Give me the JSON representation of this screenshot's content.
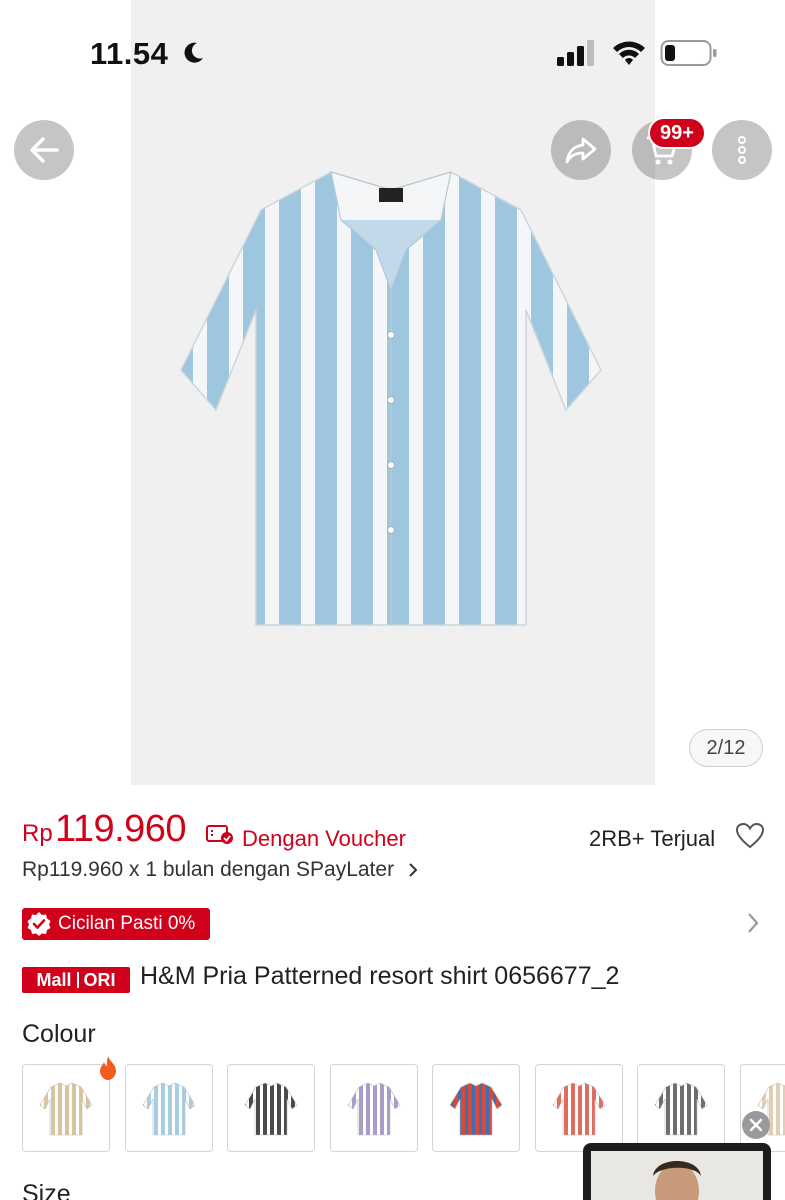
{
  "status_bar": {
    "time": "11.54",
    "icons": [
      "moon-icon",
      "signal-icon",
      "wifi-icon",
      "battery-icon"
    ]
  },
  "header": {
    "back_icon": "arrow-left-icon",
    "share_icon": "share-icon",
    "cart_icon": "cart-icon",
    "cart_badge": "99+",
    "more_icon": "more-vertical-icon"
  },
  "gallery": {
    "counter": "2/12",
    "shirt_colors": {
      "light": "#9ec6df",
      "white": "#f4f6f8"
    }
  },
  "price": {
    "currency": "Rp",
    "value": "119.960",
    "voucher_text": "Dengan Voucher",
    "sold_text": "2RB+ Terjual",
    "paylater_text": "Rp119.960 x 1 bulan dengan SPayLater"
  },
  "cicilan": {
    "text": "Cicilan Pasti 0%"
  },
  "product": {
    "badge_mall": "Mall",
    "badge_ori": "ORI",
    "title": "H&M Pria Patterned resort shirt 0656677_2"
  },
  "colour": {
    "label": "Colour",
    "swatches": [
      {
        "name": "beige-stripe",
        "color": "#d8c4a0",
        "stripe": "#ffffff"
      },
      {
        "name": "lightblue-stripe",
        "color": "#a8cce6",
        "stripe": "#ffffff"
      },
      {
        "name": "black-stripe",
        "color": "#4a4a4a",
        "stripe": "#ffffff"
      },
      {
        "name": "purple-pattern",
        "color": "#a89cc8",
        "stripe": "#ffffff"
      },
      {
        "name": "red-blue-pattern",
        "color": "#d94a3a",
        "stripe": "#3f6fb0"
      },
      {
        "name": "red-floral",
        "color": "#e06b60",
        "stripe": "#ffffff"
      },
      {
        "name": "grey-leaf",
        "color": "#6e6e6e",
        "stripe": "#ffffff"
      },
      {
        "name": "beige-partial",
        "color": "#e2cfb3",
        "stripe": "#ffffff"
      }
    ]
  },
  "size": {
    "label": "Size"
  },
  "brand_colors": {
    "accent": "#d0011b"
  }
}
